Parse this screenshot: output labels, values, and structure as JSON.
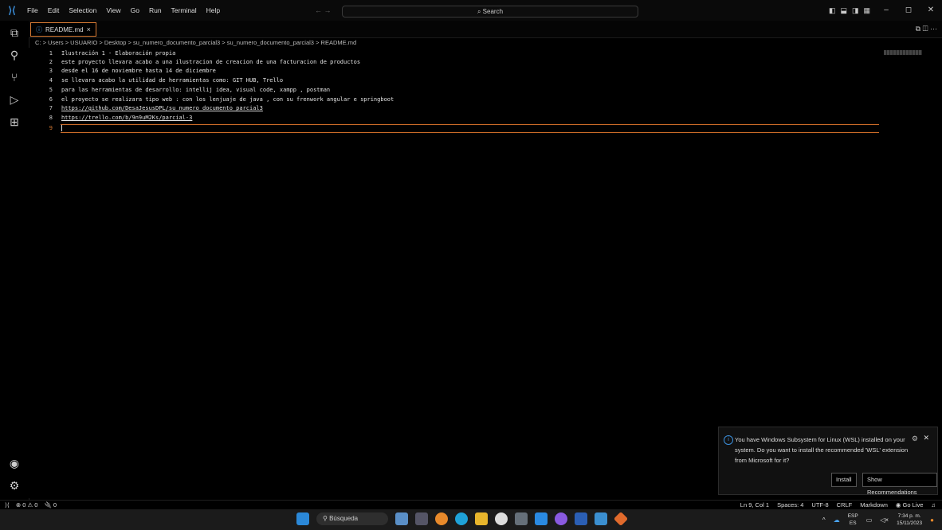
{
  "titlebar": {
    "menu": [
      "File",
      "Edit",
      "Selection",
      "View",
      "Go",
      "Run",
      "Terminal",
      "Help"
    ],
    "nav_arrows": "← →",
    "search_label": "Search",
    "window_controls": [
      "–",
      "◻",
      "✕"
    ]
  },
  "tab": {
    "label": "README.md",
    "close": "×"
  },
  "breadcrumb": "C: > Users > USUARIO > Desktop > su_numero_documento_parcial3 > su_numero_documento_parcial3 > README.md",
  "editor": {
    "lines": [
      {
        "n": "1",
        "t": "Ilustración 1 - Elaboración propia"
      },
      {
        "n": "2",
        "t": "este proyecto llevara acabo a una ilustracion de creacion de una facturacion de productos"
      },
      {
        "n": "3",
        "t": "desde el 16 de noviembre hasta 14 de diciembre"
      },
      {
        "n": "4",
        "t": "se llevara acabo la utilidad de herramientas como: GIT HUB, Trello"
      },
      {
        "n": "5",
        "t": "para las herramientas de desarrollo: intellij idea, visual code, xampp , postman"
      },
      {
        "n": "6",
        "t": "el proyecto se realizara tipo web : con los lenjuaje de java , con su frenwork angular e springboot"
      },
      {
        "n": "7",
        "t": "https://github.com/DesaJesusDPL/su_numero_documento_parcial3"
      },
      {
        "n": "8",
        "t": "https://trello.com/b/9n9uM2Ks/parcial-3"
      },
      {
        "n": "9",
        "t": ""
      }
    ]
  },
  "status": {
    "left": [
      "⊗ 0 ⚠ 0",
      "🔌 0"
    ],
    "right": [
      "Ln 9, Col 1",
      "Spaces: 4",
      "UTF-8",
      "CRLF",
      "Markdown",
      "Go Live"
    ]
  },
  "notification": {
    "message": "You have Windows Subsystem for Linux (WSL) installed on your system. Do you want to install the recommended 'WSL' extension from Microsoft for it?",
    "install": "Install",
    "show": "Show Recommendations"
  },
  "taskbar": {
    "search": "Búsqueda",
    "lang_top": "ESP",
    "lang_bottom": "ES",
    "time": "7:34 p. m.",
    "date": "15/11/2023"
  },
  "colors": {
    "accent": "#d67a33",
    "info": "#3b8fdb"
  }
}
